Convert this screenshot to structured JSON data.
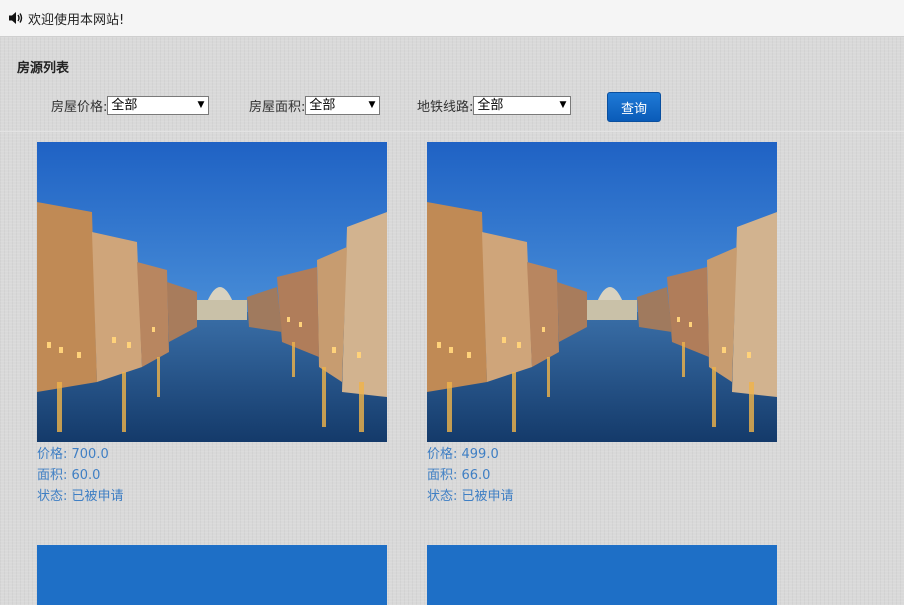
{
  "topbar": {
    "icon": "speaker-icon",
    "welcome_text": "欢迎使用本网站!"
  },
  "section": {
    "title": "房源列表"
  },
  "filters": {
    "price": {
      "label": "房屋价格:",
      "selected": "全部"
    },
    "area": {
      "label": "房屋面积:",
      "selected": "全部"
    },
    "subway": {
      "label": "地铁线路:",
      "selected": "全部"
    },
    "query_button": "查询"
  },
  "listings": [
    {
      "price_text": "价格: 700.0",
      "area_text": "面积: 60.0",
      "status_text": "状态: 已被申请"
    },
    {
      "price_text": "价格: 499.0",
      "area_text": "面积: 66.0",
      "status_text": "状态: 已被申请"
    }
  ],
  "colors": {
    "accent_button": "#0a5bb8",
    "info_text": "#3f7fc4"
  }
}
